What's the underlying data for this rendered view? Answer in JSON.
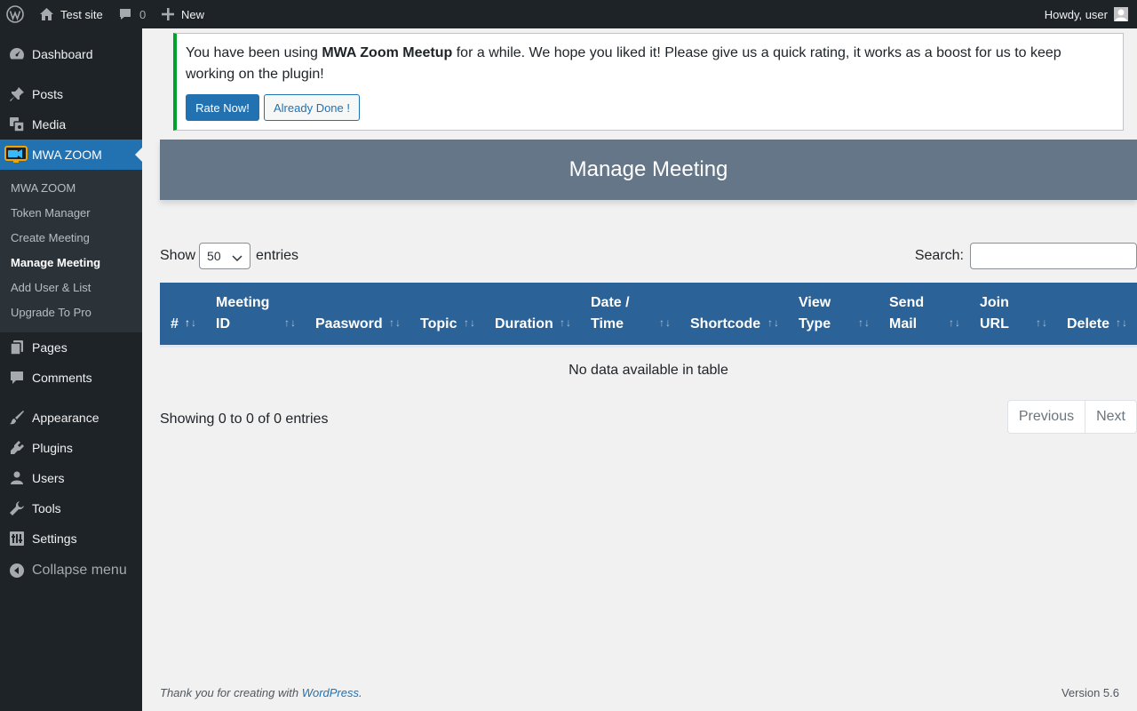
{
  "adminbar": {
    "site_name": "Test site",
    "comments_count": "0",
    "new_label": "New",
    "greeting": "Howdy, user"
  },
  "sidebar": {
    "items": [
      {
        "label": "Dashboard",
        "icon": "dashboard-icon"
      },
      {
        "label": "Posts",
        "icon": "pushpin-icon"
      },
      {
        "label": "Media",
        "icon": "media-icon"
      },
      {
        "label": "MWA ZOOM",
        "icon": "zoom-camera-icon"
      },
      {
        "label": "Pages",
        "icon": "pages-icon"
      },
      {
        "label": "Comments",
        "icon": "comment-icon"
      },
      {
        "label": "Appearance",
        "icon": "paintbrush-icon"
      },
      {
        "label": "Plugins",
        "icon": "plugin-icon"
      },
      {
        "label": "Users",
        "icon": "users-icon"
      },
      {
        "label": "Tools",
        "icon": "wrench-icon"
      },
      {
        "label": "Settings",
        "icon": "settings-icon"
      }
    ],
    "collapse_label": "Collapse menu",
    "submenu": [
      {
        "label": "MWA ZOOM"
      },
      {
        "label": "Token Manager"
      },
      {
        "label": "Create Meeting"
      },
      {
        "label": "Manage Meeting"
      },
      {
        "label": "Add User & List"
      },
      {
        "label": "Upgrade To Pro"
      }
    ]
  },
  "notice": {
    "text_before": "You have been using ",
    "plugin_name": "MWA Zoom Meetup",
    "text_after": " for a while. We hope you liked it! Please give us a quick rating, it works as a boost for us to keep working on the plugin!",
    "rate_label": "Rate Now!",
    "done_label": "Already Done !"
  },
  "page": {
    "title": "Manage Meeting"
  },
  "table_controls": {
    "show_label": "Show",
    "length_value": "50",
    "entries_label": "entries",
    "search_label": "Search:",
    "search_value": ""
  },
  "table": {
    "columns": [
      {
        "line1": "#",
        "line2": ""
      },
      {
        "line1": "Meeting",
        "line2": "ID"
      },
      {
        "line1": "Paasword",
        "line2": ""
      },
      {
        "line1": "Topic",
        "line2": ""
      },
      {
        "line1": "Duration",
        "line2": ""
      },
      {
        "line1": "Date /",
        "line2": "Time"
      },
      {
        "line1": "Shortcode",
        "line2": ""
      },
      {
        "line1": "View",
        "line2": "Type"
      },
      {
        "line1": "Send",
        "line2": "Mail"
      },
      {
        "line1": "Join",
        "line2": "URL"
      },
      {
        "line1": "Delete",
        "line2": ""
      }
    ],
    "empty_message": "No data available in table",
    "info": "Showing 0 to 0 of 0 entries",
    "prev_label": "Previous",
    "next_label": "Next"
  },
  "footer": {
    "thanks_prefix": "Thank you for creating with ",
    "thanks_link": "WordPress",
    "thanks_suffix": ".",
    "version": "Version 5.6"
  },
  "colors": {
    "admin_bg": "#1d2327",
    "accent": "#2271b1",
    "header_bar": "#647687",
    "table_head": "#2b6298",
    "notice_border": "#00a32a"
  }
}
